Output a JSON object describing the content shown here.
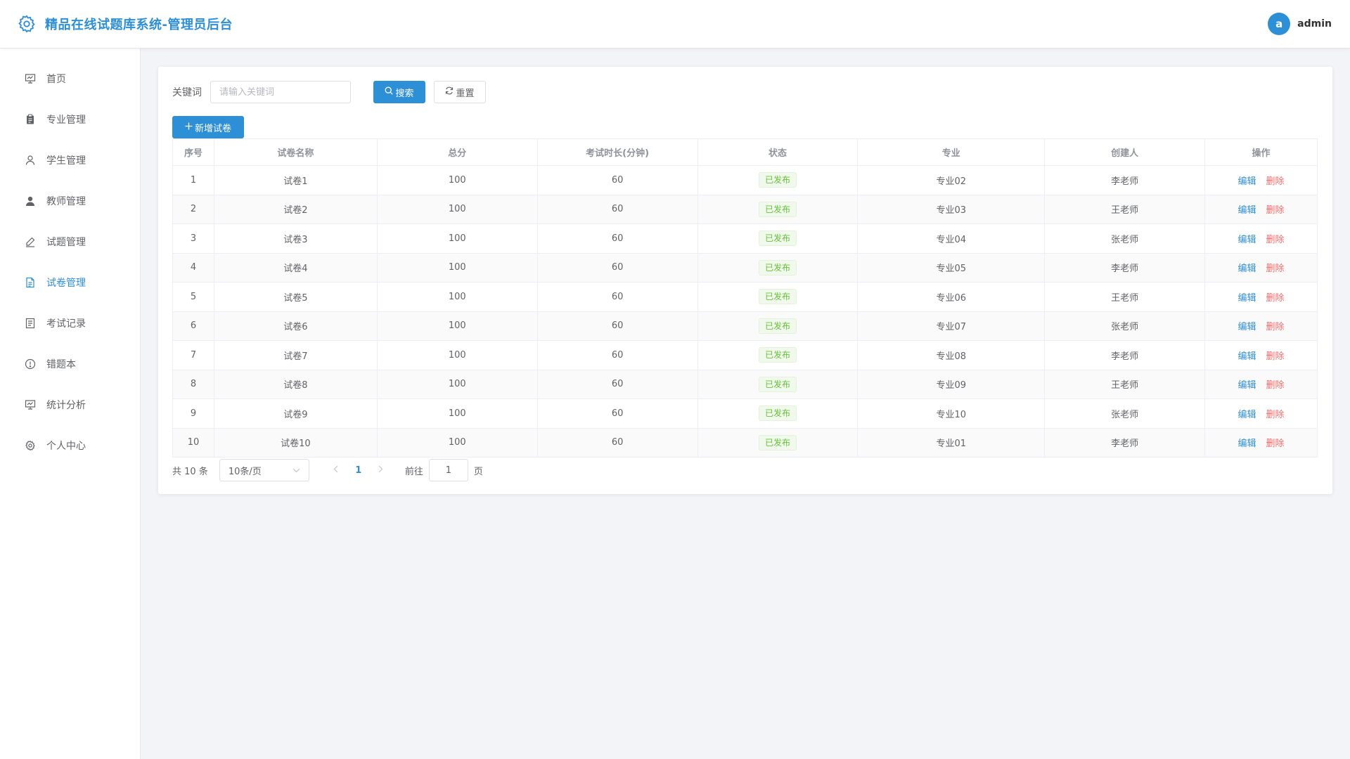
{
  "app": {
    "title": "精品在线试题库系统-管理员后台",
    "user": {
      "avatar_letter": "a",
      "name": "admin"
    }
  },
  "sidebar": {
    "items": [
      {
        "label": "首页",
        "icon": "dashboard-icon",
        "active": false
      },
      {
        "label": "专业管理",
        "icon": "clipboard-icon",
        "active": false
      },
      {
        "label": "学生管理",
        "icon": "user-outline-icon",
        "active": false
      },
      {
        "label": "教师管理",
        "icon": "user-solid-icon",
        "active": false
      },
      {
        "label": "试题管理",
        "icon": "edit-pen-icon",
        "active": false
      },
      {
        "label": "试卷管理",
        "icon": "document-icon",
        "active": true
      },
      {
        "label": "考试记录",
        "icon": "tickets-icon",
        "active": false
      },
      {
        "label": "错题本",
        "icon": "warning-circle-icon",
        "active": false
      },
      {
        "label": "统计分析",
        "icon": "chart-board-icon",
        "active": false
      },
      {
        "label": "个人中心",
        "icon": "gear-icon",
        "active": false
      }
    ]
  },
  "filter": {
    "keyword_label": "关键词",
    "keyword_placeholder": "请输入关键词",
    "keyword_value": "",
    "search_label": "搜索",
    "reset_label": "重置",
    "add_label": "新增试卷"
  },
  "table": {
    "headers": [
      "序号",
      "试卷名称",
      "总分",
      "考试时长(分钟)",
      "状态",
      "专业",
      "创建人",
      "操作"
    ],
    "edit_label": "编辑",
    "delete_label": "删除",
    "rows": [
      {
        "index": "1",
        "name": "试卷1",
        "score": "100",
        "duration": "60",
        "status": "已发布",
        "major": "专业02",
        "creator": "李老师"
      },
      {
        "index": "2",
        "name": "试卷2",
        "score": "100",
        "duration": "60",
        "status": "已发布",
        "major": "专业03",
        "creator": "王老师"
      },
      {
        "index": "3",
        "name": "试卷3",
        "score": "100",
        "duration": "60",
        "status": "已发布",
        "major": "专业04",
        "creator": "张老师"
      },
      {
        "index": "4",
        "name": "试卷4",
        "score": "100",
        "duration": "60",
        "status": "已发布",
        "major": "专业05",
        "creator": "李老师"
      },
      {
        "index": "5",
        "name": "试卷5",
        "score": "100",
        "duration": "60",
        "status": "已发布",
        "major": "专业06",
        "creator": "王老师"
      },
      {
        "index": "6",
        "name": "试卷6",
        "score": "100",
        "duration": "60",
        "status": "已发布",
        "major": "专业07",
        "creator": "张老师"
      },
      {
        "index": "7",
        "name": "试卷7",
        "score": "100",
        "duration": "60",
        "status": "已发布",
        "major": "专业08",
        "creator": "李老师"
      },
      {
        "index": "8",
        "name": "试卷8",
        "score": "100",
        "duration": "60",
        "status": "已发布",
        "major": "专业09",
        "creator": "王老师"
      },
      {
        "index": "9",
        "name": "试卷9",
        "score": "100",
        "duration": "60",
        "status": "已发布",
        "major": "专业10",
        "creator": "张老师"
      },
      {
        "index": "10",
        "name": "试卷10",
        "score": "100",
        "duration": "60",
        "status": "已发布",
        "major": "专业01",
        "creator": "李老师"
      }
    ]
  },
  "pagination": {
    "total_text": "共 10 条",
    "page_size": "10条/页",
    "current_page": "1",
    "goto_label": "前往",
    "goto_value": "1",
    "goto_suffix": "页"
  },
  "colors": {
    "accent": "#2d8fd6",
    "danger": "#f56c6c",
    "success": "#67c23a"
  }
}
